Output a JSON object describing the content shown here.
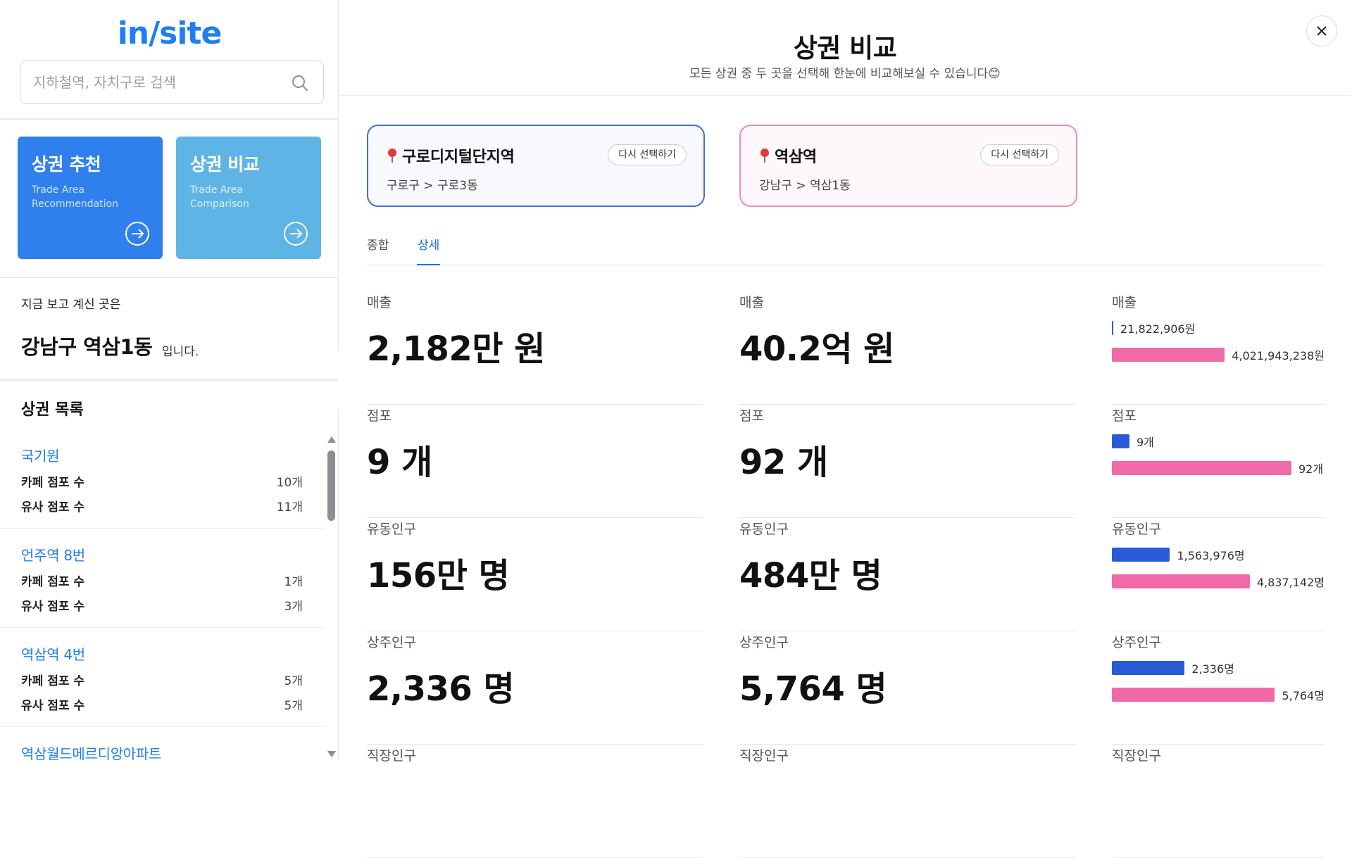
{
  "sidebar": {
    "logo": "in/site",
    "search_placeholder": "지하철역, 자치구로 검색",
    "cards": {
      "recommend": {
        "title": "상권 추천",
        "sub": "Trade Area Recommendation"
      },
      "compare": {
        "title": "상권 비교",
        "sub": "Trade Area Comparison"
      }
    },
    "current_label": "지금 보고 계신 곳은",
    "current_region": "강남구 역삼1동",
    "current_suffix": "입니다.",
    "list_title": "상권 목록",
    "list": [
      {
        "name": "국기원",
        "cafe_label": "카페 점포 수",
        "cafe": "10개",
        "similar_label": "유사 점포 수",
        "similar": "11개"
      },
      {
        "name": "언주역 8번",
        "cafe_label": "카페 점포 수",
        "cafe": "1개",
        "similar_label": "유사 점포 수",
        "similar": "3개"
      },
      {
        "name": "역삼역 4번",
        "cafe_label": "카페 점포 수",
        "cafe": "5개",
        "similar_label": "유사 점포 수",
        "similar": "5개"
      },
      {
        "name": "역삼월드메르디앙아파트"
      }
    ]
  },
  "main": {
    "title": "상권 비교",
    "subtitle": "모든 상권 중 두 곳을 선택해 한눈에 비교해보실 수 있습니다😊",
    "area_a": {
      "name": "구로디지털단지역",
      "path": "구로구 > 구로3동",
      "reselect": "다시 선택하기"
    },
    "area_b": {
      "name": "역삼역",
      "path": "강남구 > 역삼1동",
      "reselect": "다시 선택하기"
    },
    "tabs": [
      "종합",
      "상세"
    ],
    "active_tab": "상세",
    "colors": {
      "area_a": "#2a5bd7",
      "area_b": "#f06aa9"
    },
    "metrics": [
      {
        "label": "매출",
        "a_big": "2,182만 원",
        "b_big": "40.2억 원",
        "a_bar": "21,822,906원",
        "b_bar": "4,021,943,238원",
        "a_raw": 21822906,
        "b_raw": 4021943238
      },
      {
        "label": "점포",
        "a_big": "9 개",
        "b_big": "92 개",
        "a_bar": "9개",
        "b_bar": "92개",
        "a_raw": 9,
        "b_raw": 92
      },
      {
        "label": "유동인구",
        "a_big": "156만 명",
        "b_big": "484만 명",
        "a_bar": "1,563,976명",
        "b_bar": "4,837,142명",
        "a_raw": 1563976,
        "b_raw": 4837142
      },
      {
        "label": "상주인구",
        "a_big": "2,336 명",
        "b_big": "5,764 명",
        "a_bar": "2,336명",
        "b_bar": "5,764명",
        "a_raw": 2336,
        "b_raw": 5764
      },
      {
        "label": "직장인구",
        "a_big": "",
        "b_big": ""
      }
    ]
  }
}
